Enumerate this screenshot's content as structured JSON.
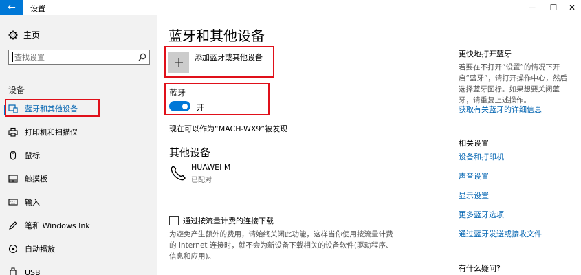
{
  "window": {
    "title": "设置",
    "back_glyph": "←",
    "minimize_glyph": "—",
    "maximize_glyph": "☐",
    "close_glyph": "✕"
  },
  "sidebar": {
    "home_label": "主页",
    "search_placeholder": "查找设置",
    "section_label": "设备",
    "items": [
      {
        "label": "蓝牙和其他设备",
        "icon": "bluetooth-devices-icon",
        "active": true
      },
      {
        "label": "打印机和扫描仪",
        "icon": "printer-icon"
      },
      {
        "label": "鼠标",
        "icon": "mouse-icon"
      },
      {
        "label": "触摸板",
        "icon": "touchpad-icon"
      },
      {
        "label": "输入",
        "icon": "keyboard-icon"
      },
      {
        "label": "笔和 Windows Ink",
        "icon": "pen-icon"
      },
      {
        "label": "自动播放",
        "icon": "autoplay-icon"
      },
      {
        "label": "USB",
        "icon": "usb-icon"
      }
    ]
  },
  "main": {
    "title": "蓝牙和其他设备",
    "add_device_label": "添加蓝牙或其他设备",
    "bluetooth_label": "蓝牙",
    "bluetooth_state": "开",
    "discoverable_text": "现在可以作为“MACH-WX9”被发现",
    "other_devices_title": "其他设备",
    "device": {
      "name": "HUAWEI M",
      "status": "已配对"
    },
    "metered_checkbox_label": "通过按流量计费的连接下载",
    "metered_note": "为避免产生额外的费用，请始终关闭此功能，这样当你使用按流量计费的 Internet 连接时，就不会为新设备下载相关的设备软件(驱动程序、信息和应用)。"
  },
  "right": {
    "quick_heading": "更快地打开蓝牙",
    "quick_body": "若要在不打开“设置”的情况下开启“蓝牙”，请打开操作中心，然后选择蓝牙图标。如果想要关闭蓝牙，请重复上述操作。",
    "quick_link": "获取有关蓝牙的详细信息",
    "related_heading": "相关设置",
    "related_links": [
      "设备和打印机",
      "声音设置",
      "显示设置",
      "更多蓝牙选项",
      "通过蓝牙发送或接收文件"
    ],
    "help_heading": "有什么疑问?"
  },
  "colors": {
    "accent": "#0078d7",
    "highlight_box": "#e0101a",
    "sidebar_bg": "#f2f2f2"
  }
}
